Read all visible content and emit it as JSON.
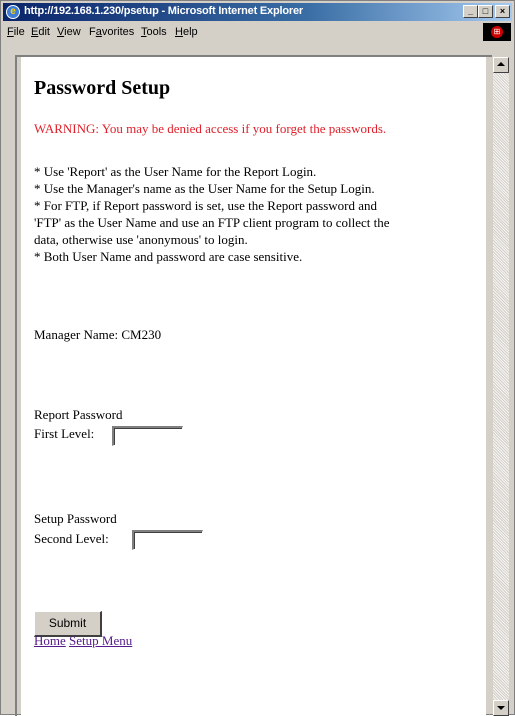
{
  "window": {
    "title": "http://192.168.1.230/psetup - Microsoft Internet Explorer"
  },
  "menubar": {
    "items": [
      {
        "key": "F",
        "rest": "ile"
      },
      {
        "key": "E",
        "rest": "dit"
      },
      {
        "key": "V",
        "rest": "iew"
      },
      {
        "key": "a",
        "pre": "F",
        "rest": "vorites"
      },
      {
        "key": "T",
        "rest": "ools"
      },
      {
        "key": "H",
        "rest": "elp"
      }
    ]
  },
  "page": {
    "title": "Password Setup",
    "warning": "WARNING: You may be denied access if you forget the passwords.",
    "notes": [
      "* Use 'Report' as the User Name for the Report Login.",
      "* Use the Manager's name as the User Name for the Setup Login.",
      "* For FTP, if Report password is set, use the Report password and",
      "'FTP' as the User Name and use an FTP client program to collect the",
      "data, otherwise use 'anonymous' to login.",
      "* Both User Name and password are case sensitive."
    ],
    "manager_name_label": "Manager Name: CM230",
    "report_password": {
      "heading": "Report Password",
      "level_label": "First Level:",
      "value": ""
    },
    "setup_password": {
      "heading": "Setup Password",
      "level_label": "Second Level:",
      "value": ""
    },
    "submit_label": "Submit",
    "links": {
      "home": "Home",
      "setup_menu": "Setup Menu"
    }
  },
  "colors": {
    "warning": "#e0202a",
    "link": "#551a8b",
    "titlebar": "#0a246a"
  }
}
